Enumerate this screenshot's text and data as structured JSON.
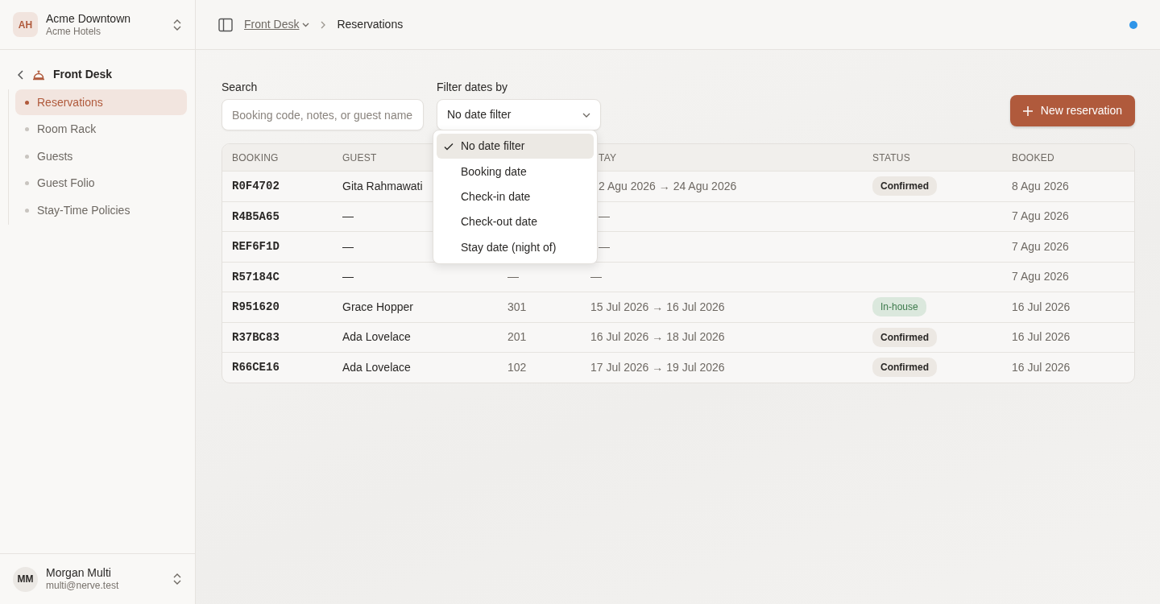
{
  "workspace": {
    "initials": "AH",
    "name": "Acme Downtown",
    "org": "Acme Hotels"
  },
  "sidebar": {
    "section": "Front Desk",
    "items": [
      {
        "label": "Reservations",
        "selected": true
      },
      {
        "label": "Room Rack",
        "selected": false
      },
      {
        "label": "Guests",
        "selected": false
      },
      {
        "label": "Guest Folio",
        "selected": false
      },
      {
        "label": "Stay-Time Policies",
        "selected": false
      }
    ]
  },
  "user": {
    "initials": "MM",
    "name": "Morgan Multi",
    "email": "multi@nerve.test"
  },
  "breadcrumb": {
    "parent": "Front Desk",
    "current": "Reservations"
  },
  "search": {
    "label": "Search",
    "placeholder": "Booking code, notes, or guest name"
  },
  "date_filter": {
    "label": "Filter dates by",
    "value": "No date filter",
    "expanded": true,
    "options": [
      {
        "label": "No date filter",
        "selected": true
      },
      {
        "label": "Booking date",
        "selected": false
      },
      {
        "label": "Check-in date",
        "selected": false
      },
      {
        "label": "Check-out date",
        "selected": false
      },
      {
        "label": "Stay date (night of)",
        "selected": false
      }
    ]
  },
  "new_button": "New reservation",
  "table": {
    "header": {
      "booking": "BOOKING",
      "guest": "GUEST",
      "stay": "TAY",
      "stay_clipped": true,
      "status": "STATUS",
      "booked": "BOOKED"
    },
    "rows": [
      {
        "booking": "R0F4702",
        "guest": "Gita Rahmawati",
        "stay": "2 Agu 2026 → 24 Agu 2026",
        "stay_clipped": true,
        "status": {
          "label": "Confirmed",
          "kind": "confirmed"
        },
        "booked": "8 Agu 2026"
      },
      {
        "booking": "R4B5A65",
        "guest": "—",
        "stay": "—",
        "stay_clipped": true,
        "booked": "7 Agu 2026"
      },
      {
        "booking": "REF6F1D",
        "guest": "—",
        "stay": "—",
        "stay_clipped": true,
        "booked": "7 Agu 2026"
      },
      {
        "booking": "R57184C",
        "guest": "—",
        "room": "—",
        "stay": "—",
        "stay_clipped": false,
        "booked": "7 Agu 2026"
      },
      {
        "booking": "R951620",
        "guest": "Grace Hopper",
        "room": "301",
        "stay": "15 Jul 2026 → 16 Jul 2026",
        "stay_clipped": false,
        "status": {
          "label": "In-house",
          "kind": "in_house"
        },
        "booked": "16 Jul 2026"
      },
      {
        "booking": "R37BC83",
        "guest": "Ada Lovelace",
        "room": "201",
        "stay": "16 Jul 2026 → 18 Jul 2026",
        "stay_clipped": false,
        "status": {
          "label": "Confirmed",
          "kind": "confirmed"
        },
        "booked": "16 Jul 2026"
      },
      {
        "booking": "R66CE16",
        "guest": "Ada Lovelace",
        "room": "102",
        "stay": "17 Jul 2026 → 19 Jul 2026",
        "stay_clipped": false,
        "status": {
          "label": "Confirmed",
          "kind": "confirmed"
        },
        "booked": "16 Jul 2026"
      }
    ]
  }
}
